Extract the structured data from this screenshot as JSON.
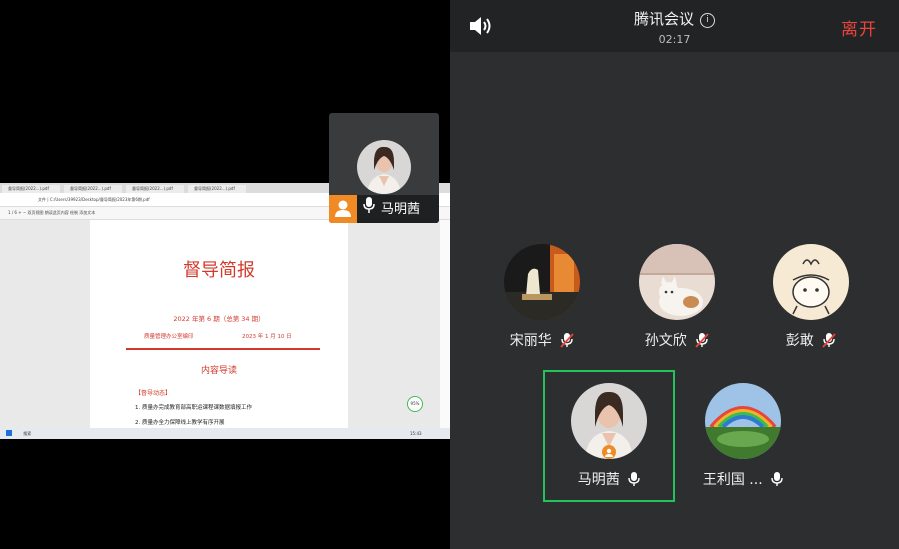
{
  "meeting": {
    "title": "腾讯会议",
    "timer": "02:17",
    "leave_label": "离开"
  },
  "participants": [
    {
      "name": "宋丽华",
      "mic": "muted"
    },
    {
      "name": "孙文欣",
      "mic": "muted"
    },
    {
      "name": "彭敢",
      "mic": "muted"
    },
    {
      "name": "马明茜",
      "mic": "on",
      "host": true,
      "selected": true
    },
    {
      "name": "王利国 ...",
      "mic": "on"
    }
  ],
  "floating_video": {
    "name": "马明茜"
  },
  "shared_screen": {
    "tabs": [
      "督导简报(2022...).pdf",
      "督导简报(2022...).pdf",
      "督导简报(2022...).pdf",
      "督导简报(2022...).pdf"
    ],
    "address": "文件 | C:/Users/39923/Desktop/督导简报/2023年第6期.pdf",
    "toolbar": "1 / 6    +  −    双页视图    朗读此页内容    绘制    添加文本",
    "document": {
      "title": "督导简报",
      "issue": "2022 年第 6 期（总第 34 期）",
      "org": "质量管理办公室编印",
      "date": "2023 年 1 月 10 日",
      "heading": "内容导读",
      "section": "【督导动态】",
      "lines": [
        "1. 质量办完成教育部高职运课程课数据填报工作",
        "2. 质量办全力保障线上教学有序开展"
      ]
    },
    "taskbar": {
      "search": "搜索",
      "time": "15:43"
    },
    "zoom": "95%"
  },
  "colors": {
    "accent_red": "#e8453c",
    "selected_border": "#22c35a",
    "host_badge": "#f08a24",
    "panel_bg": "#2d2e30"
  }
}
